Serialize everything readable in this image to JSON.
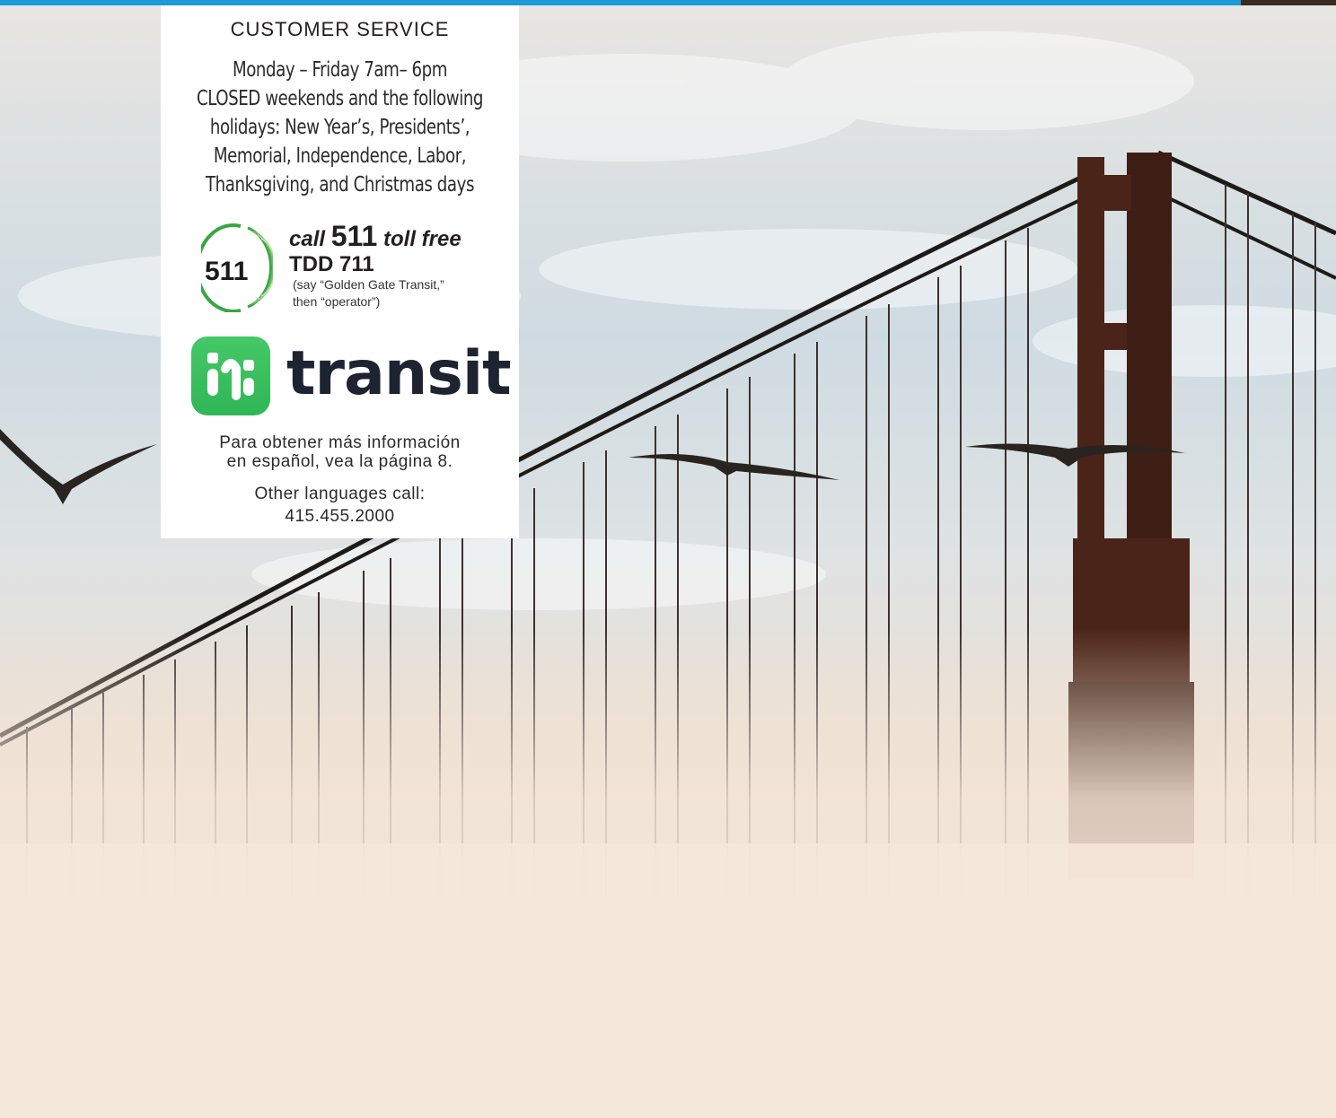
{
  "customer_service": {
    "heading": "CUSTOMER SERVICE",
    "hours_lines": [
      "Monday – Friday 7am– 6pm",
      "CLOSED weekends and the following",
      "holidays: New Year’s, Presidents’,",
      "Memorial, Independence, Labor,",
      "Thanksgiving, and Christmas days"
    ]
  },
  "phone": {
    "logo_text": "511",
    "call_prefix": "call",
    "call_number": "511",
    "call_suffix": "toll free",
    "tdd": "TDD 711",
    "say_line1": "(say “Golden Gate Transit,”",
    "say_line2": "then “operator”)"
  },
  "transit_app": {
    "icon": "transit-app-icon",
    "wordmark": "transit"
  },
  "spanish": {
    "line1": "Para obtener más información",
    "line2": "en español, vea la página 8."
  },
  "other_languages": {
    "line1": "Other languages call:",
    "line2": "415.455.2000"
  },
  "colors": {
    "top_bar": "#1a9bd8",
    "transit_green": "#30b657",
    "logo_green": "#3aa543"
  }
}
